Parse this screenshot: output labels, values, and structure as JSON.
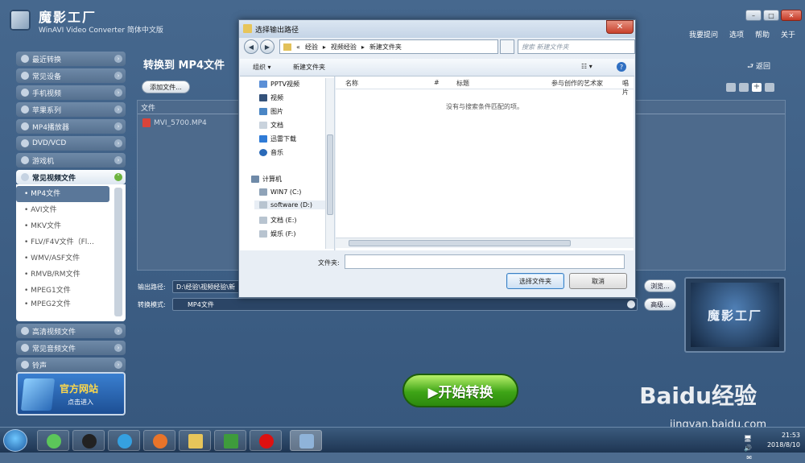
{
  "app": {
    "title": "魔影工厂",
    "subtitle": "WinAVI Video Converter 简体中文版",
    "top_menu": [
      "我要提问",
      "选项",
      "帮助",
      "关于"
    ],
    "window_buttons": [
      "–",
      "□",
      "✕"
    ]
  },
  "sidebar": {
    "categories_top": [
      {
        "label": "最近转换",
        "icon": "clock-icon"
      },
      {
        "label": "常见设备",
        "icon": "device-icon"
      },
      {
        "label": "手机视频",
        "icon": "phone-icon"
      },
      {
        "label": "苹果系列",
        "icon": "apple-icon"
      },
      {
        "label": "MP4播放器",
        "icon": "player-icon"
      },
      {
        "label": "DVD/VCD",
        "icon": "disc-icon"
      },
      {
        "label": "游戏机",
        "icon": "gamepad-icon"
      }
    ],
    "open_category": "常见视频文件",
    "sub_items": [
      "• MP4文件",
      "• AVI文件",
      "• MKV文件",
      "• FLV/F4V文件（Fl...",
      "• WMV/ASF文件",
      "• RMVB/RM文件",
      "• MPEG1文件",
      "• MPEG2文件"
    ],
    "categories_bottom": [
      {
        "label": "高清视频文件",
        "icon": "hd-icon"
      },
      {
        "label": "常见音频文件",
        "icon": "music-icon"
      },
      {
        "label": "铃声",
        "icon": "bell-icon"
      }
    ],
    "banner_title": "官方网站",
    "banner_sub": "点击进入"
  },
  "main": {
    "title": "转换到 MP4文件",
    "back": "返回",
    "add_file": "添加文件...",
    "file_col": "文件",
    "files": [
      "MVI_5700.MP4"
    ],
    "output_label": "输出路径:",
    "output_path": "D:\\经验\\视频经验\\新",
    "mode_label": "转换模式:",
    "mode_value": "MP4文件",
    "browse": "浏览...",
    "advanced": "高级...",
    "preview_text": "魔影工厂",
    "start": "▶开始转换"
  },
  "dialog": {
    "title": "选择输出路径",
    "close": "✕",
    "address": [
      "«",
      "经验",
      "▸",
      "视频经验",
      "▸",
      "新建文件夹"
    ],
    "search_placeholder": "搜索 新建文件夹",
    "organize": "组织 ▾",
    "new_folder": "新建文件夹",
    "view": "☷ ▾",
    "nav_items": [
      "PPTV视频",
      "视频",
      "图片",
      "文档",
      "迅雷下载",
      "音乐"
    ],
    "computer": "计算机",
    "drives": [
      "WIN7 (C:)",
      "software (D:)",
      "文档 (E:)",
      "娱乐 (F:)"
    ],
    "columns": [
      "名称",
      "#",
      "标题",
      "参与创作的艺术家",
      "唱片"
    ],
    "empty_text": "没有与搜索条件匹配的项。",
    "folder_label": "文件夹:",
    "folder_value": "",
    "ok": "选择文件夹",
    "cancel": "取消"
  },
  "watermark": {
    "brand": "Baidu经验",
    "url": "jingyan.baidu.com"
  },
  "taskbar": {
    "time": "21:53",
    "date": "2018/8/10",
    "tray_text": "🖥 🔊 ✉"
  },
  "colors": {
    "accent": "#3ea417",
    "window_bg": "#46688e",
    "selection": "#5a7799"
  }
}
